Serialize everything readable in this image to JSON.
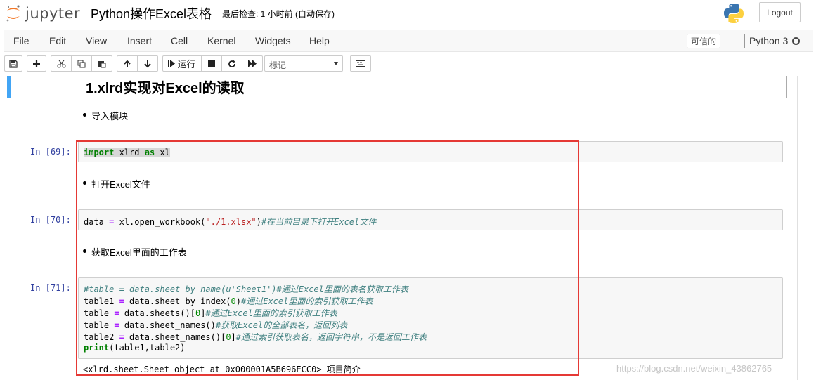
{
  "header": {
    "logo_text": "jupyter",
    "notebook_title": "Python操作Excel表格",
    "checkpoint": "最后检查: 1 小时前  (自动保存)",
    "logout_label": "Logout"
  },
  "menubar": {
    "items": [
      "File",
      "Edit",
      "View",
      "Insert",
      "Cell",
      "Kernel",
      "Widgets",
      "Help"
    ],
    "trusted_label": "可信的",
    "kernel_name": "Python 3"
  },
  "toolbar": {
    "run_label": "运行",
    "cell_type": "标记"
  },
  "cells": {
    "heading": "1.xlrd实现对Excel的读取",
    "bullet1": "导入模块",
    "prompt69": "In [69]:",
    "code69": "import xlrd as xl",
    "bullet2": "打开Excel文件",
    "prompt70": "In [70]:",
    "code70": "data = xl.open_workbook(\"./1.xlsx\")#在当前目录下打开Excel文件",
    "bullet3": "获取Excel里面的工作表",
    "prompt71": "In [71]:",
    "code71": [
      "#table = data.sheet_by_name(u'Sheet1')#通过Excel里面的表名获取工作表",
      "table1 = data.sheet_by_index(0)#通过Excel里面的索引获取工作表",
      "table = data.sheets()[0]#通过Excel里面的索引获取工作表",
      "table = data.sheet_names()#获取Excel的全部表名，返回列表",
      "table2 = data.sheet_names()[0]#通过索引获取表名，返回字符串，不是返回工作表",
      "print(table1,table2)"
    ],
    "output71": "<xlrd.sheet.Sheet object at 0x000001A5B696ECC0> 项目简介"
  },
  "watermark": "https://blog.csdn.net/weixin_43862765",
  "colors": {
    "prompt": "#303f9f",
    "selected_bar": "#42a5f5",
    "annotation_box": "#e53935",
    "keyword": "#008000",
    "comment": "#408080",
    "string": "#ba2121"
  }
}
